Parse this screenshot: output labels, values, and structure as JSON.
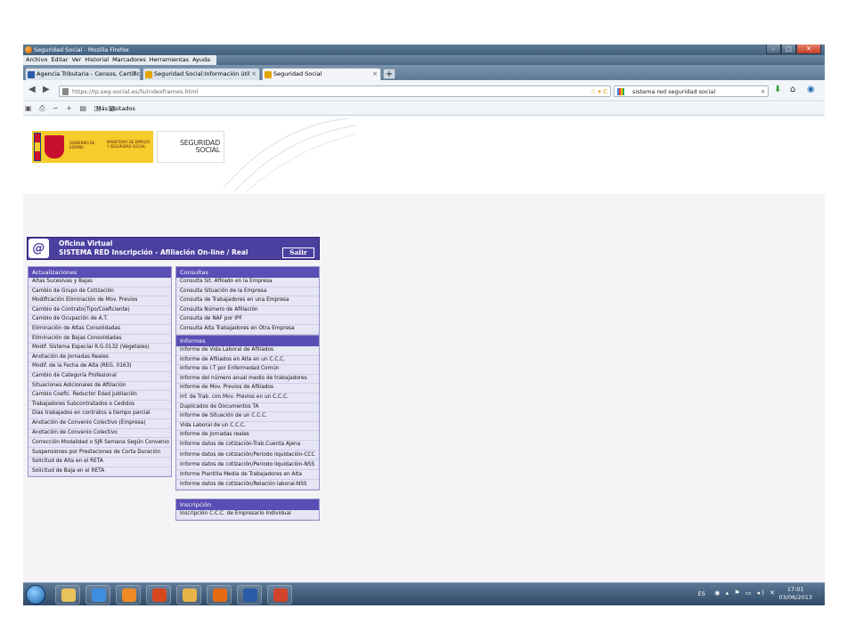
{
  "window": {
    "title": "Seguridad Social - Mozilla Firefox"
  },
  "menubar": [
    "Archivo",
    "Editar",
    "Ver",
    "Historial",
    "Marcadores",
    "Herramientas",
    "Ayuda"
  ],
  "tabs": [
    {
      "label": "Agencia Tributaria - Censos, Certifica...",
      "icon_color": "#2b5aa6"
    },
    {
      "label": "Seguridad Social:Información útil",
      "icon_color": "#e6a400"
    },
    {
      "label": "Seguridad Social",
      "icon_color": "#e6a400"
    }
  ],
  "nav": {
    "url": "https://tp.seg-social.es/fs/indexframes.html",
    "search_query": "sistema red seguridad social"
  },
  "bookmarks": {
    "label": "Más visitados"
  },
  "logos": {
    "gobierno": "GOBIERNO DE ESPAÑA",
    "ministerio": "MINISTERIO DE EMPLEO Y SEGURIDAD SOCIAL",
    "ss_line1": "SEGURIDAD",
    "ss_line2": "SOCIAL"
  },
  "ov": {
    "title": "Oficina Virtual",
    "subtitle": "SISTEMA RED Inscripción - Afiliación On-line / Real",
    "salir": "Salir"
  },
  "actualizaciones": {
    "title": "Actualizaciones",
    "items": [
      "Altas Sucesivas y Bajas",
      "Cambio de Grupo de Cotización",
      "Modificación Eliminación de Mov. Previos",
      "Cambio de Contrato(Tipo/Coeficiente)",
      "Cambio de Ocupación de A.T.",
      "Eliminación de Altas Consolidadas",
      "Eliminación de Bajas Consolidadas",
      "Modif. Sistema Especial R.G.0132 (Vegetales)",
      "Anotación de Jornadas Reales",
      "Modif. de la Fecha de Alta (REG. 0163)",
      "Cambio de Categoría Profesional",
      "Situaciones Adicionales de Afiliación",
      "Cambio Coefic. Reductor Edad Jubilación",
      "Trabajadores Subcontratados o Cedidos",
      "Días trabajados en contratos a tiempo parcial",
      "Anotación de Convenio Colectivo (Empresa)",
      "Anotación de Convenio Colectivo",
      "Corrección Modalidad o SJR Semana Según Convenio",
      "Suspensiones por Prestaciones de Corta Duración",
      "Solicitud de Alta en el RETA",
      "Solicitud de Baja en el RETA"
    ]
  },
  "consultas": {
    "title": "Consultas",
    "items": [
      "Consulta Sit. Afiliado en la Empresa",
      "Consulta Situación de la Empresa",
      "Consulta de Trabajadores en una Empresa",
      "Consulta Número de Afiliación",
      "Consulta de NAF por IPF",
      "Consulta Alta Trabajadores en Otra Empresa"
    ]
  },
  "informes": {
    "title": "Informes",
    "items": [
      "Informe de Vida Laboral de Afiliados",
      "Informe de Afiliados en Alta en un C.C.C.",
      "Informe de I.T por Enfermedad Común",
      "Informe del número anual medio de trabajadores",
      "Informe de Mov. Previos de Afiliados",
      "Inf. de Trab. con Mov. Previos en un C.C.C.",
      "Duplicados de Documentos TA",
      "Informe de Situación de un C.C.C.",
      "Vida Laboral de un C.C.C.",
      "Informe de Jornadas reales",
      "Informe datos de cotización-Trab.Cuenta Ajena",
      "Informe datos de cotización/Periodo liquidación-CCC",
      "Informe datos de cotización/Periodo liquidación-NSS",
      "Informe Plantilla Media de Trabajadores en Alta",
      "Informe datos de cotización/Relación laboral-NSS"
    ]
  },
  "inscripcion": {
    "title": "Inscripción",
    "items": [
      "Inscripción C.C.C. de Empresario Individual"
    ]
  },
  "taskbar": {
    "apps": [
      {
        "name": "explorer",
        "color": "#e7c35a"
      },
      {
        "name": "internet-explorer",
        "color": "#3d8ee0"
      },
      {
        "name": "media-player",
        "color": "#f08a24"
      },
      {
        "name": "office",
        "color": "#d8481f"
      },
      {
        "name": "outlook",
        "color": "#e8b44a"
      },
      {
        "name": "firefox",
        "color": "#e56a12"
      },
      {
        "name": "word",
        "color": "#2a5ba8"
      },
      {
        "name": "powerpoint",
        "color": "#d2442a"
      }
    ],
    "lang": "ES",
    "time": "17:01",
    "date": "03/06/2013"
  }
}
